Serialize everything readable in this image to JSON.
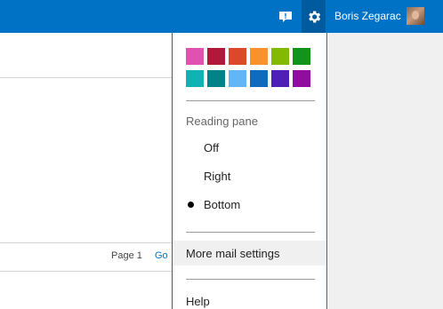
{
  "header": {
    "user_name": "Boris Zegarac",
    "icons": [
      "feedback-icon",
      "gear-icon"
    ],
    "bar_color": "#0072c6"
  },
  "list": {
    "page_label": "Page 1",
    "go_label": "Go"
  },
  "settings_menu": {
    "theme_colors": [
      "#e052b0",
      "#b0193c",
      "#da4a2a",
      "#f7922e",
      "#82ba00",
      "#12931c",
      "#10b3b3",
      "#038387",
      "#64b5f6",
      "#0f6cbd",
      "#4e20b5",
      "#8f0e9f"
    ],
    "reading_pane_label": "Reading pane",
    "reading_pane_options": [
      "Off",
      "Right",
      "Bottom"
    ],
    "selected_option": "Bottom",
    "more_settings_label": "More mail settings",
    "help_label": "Help"
  }
}
